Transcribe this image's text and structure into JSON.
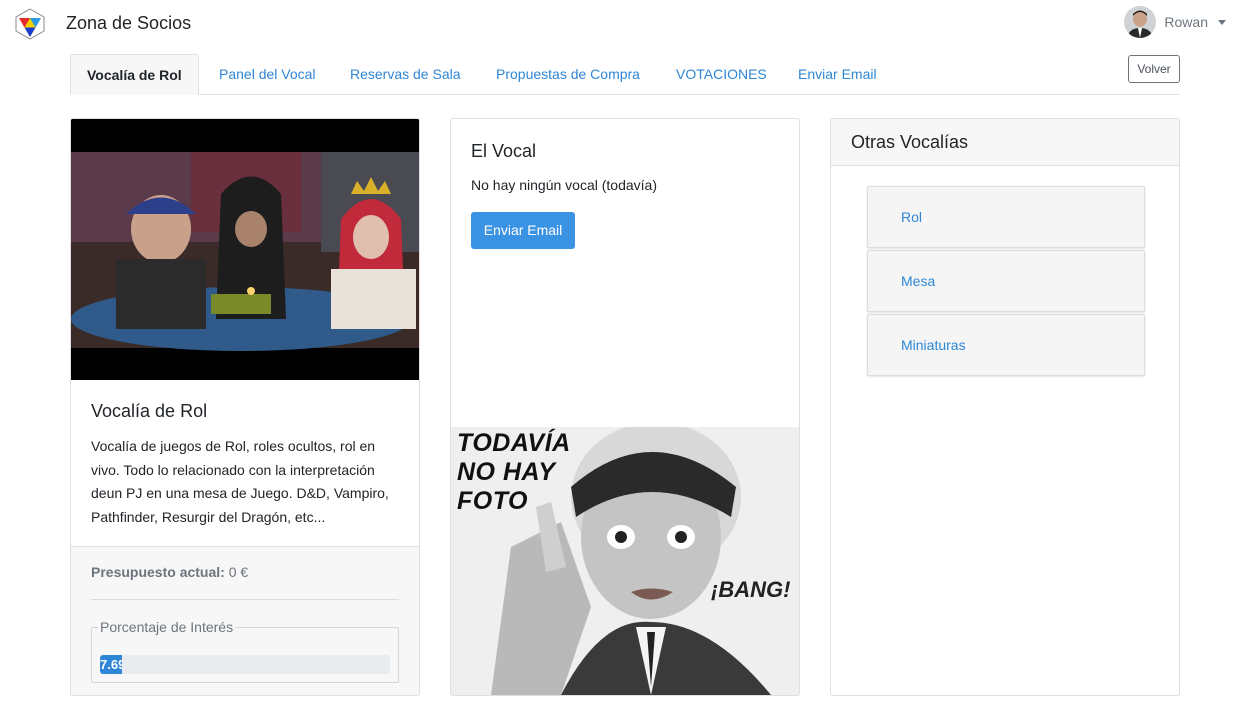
{
  "header": {
    "brand": "Zona de Socios",
    "user_name": "Rowan"
  },
  "tabs": [
    {
      "label": "Vocalía de Rol",
      "active": true
    },
    {
      "label": "Panel del Vocal",
      "active": false
    },
    {
      "label": "Reservas de Sala",
      "active": false
    },
    {
      "label": "Propuestas de Compra",
      "active": false
    },
    {
      "label": "VOTACIONES",
      "active": false
    },
    {
      "label": "Enviar Email",
      "active": false
    }
  ],
  "back_button": "Volver",
  "vocalia": {
    "title": "Vocalía de Rol",
    "description": "Vocalía de juegos de Rol, roles ocultos, rol en vivo. Todo lo relacionado con la interpretación deun PJ en una mesa de Juego. D&D, Vampiro, Pathfinder, Resurgir del Dragón, etc...",
    "budget_label": "Presupuesto actual:",
    "budget_value": "0 €",
    "interest_legend": "Porcentaje de Interés",
    "interest_percent": 7.69,
    "interest_text": "7.69"
  },
  "vocal": {
    "title": "El Vocal",
    "text": "No hay ningún vocal (todavía)",
    "email_button": "Enviar Email",
    "placeholder_lines": [
      "TODAVÍA",
      "NO HAY",
      "FOTO"
    ],
    "placeholder_bang": "¡BANG!"
  },
  "otras": {
    "title": "Otras Vocalías",
    "items": [
      "Rol",
      "Mesa",
      "Miniaturas"
    ]
  },
  "colors": {
    "primary": "#2f86d6",
    "button": "#3a93e2"
  }
}
